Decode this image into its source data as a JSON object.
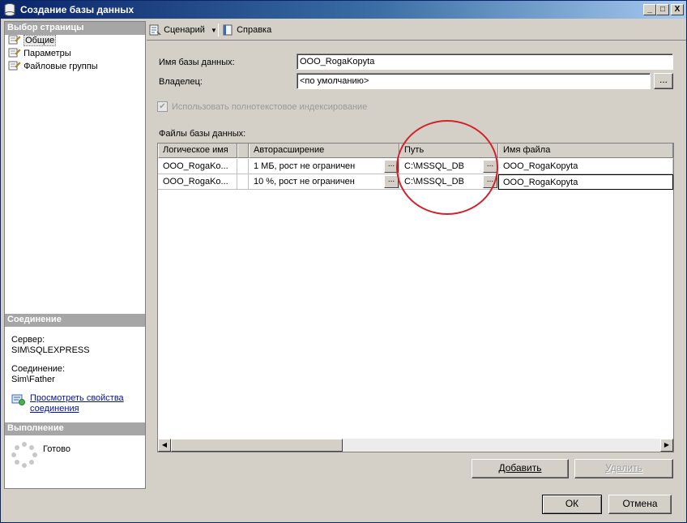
{
  "window": {
    "title": "Создание базы данных",
    "controls": {
      "minimize": "_",
      "maximize": "□",
      "close": "X"
    }
  },
  "left_pane": {
    "header": "Выбор страницы",
    "items": [
      {
        "label": "Общие",
        "selected": true,
        "icon": "page-icon"
      },
      {
        "label": "Параметры",
        "selected": false,
        "icon": "page-icon"
      },
      {
        "label": "Файловые группы",
        "selected": false,
        "icon": "page-icon"
      }
    ],
    "connection": {
      "header": "Соединение",
      "server_label": "Сервер:",
      "server_value": "SIM\\SQLEXPRESS",
      "connection_label": "Соединение:",
      "connection_value": "Sim\\Father",
      "view_props_link": "Просмотреть свойства соединения"
    },
    "execution": {
      "header": "Выполнение",
      "status": "Готово"
    }
  },
  "toolbar": {
    "script_label": "Сценарий",
    "help_label": "Справка"
  },
  "form": {
    "db_name_label": "Имя базы данных:",
    "db_name_value": "OOO_RogaKopyta",
    "owner_label": "Владелец:",
    "owner_value": "<по умолчанию>",
    "fulltext_label": "Использовать полнотекстовое индексирование",
    "fulltext_checked": true,
    "files_label": "Файлы базы данных:"
  },
  "grid": {
    "columns": [
      "Логическое имя",
      "Авторасширение",
      "Путь",
      "Имя файла"
    ],
    "rows": [
      {
        "logical": "OOO_RogaKo...",
        "autogrow": "1 МБ, рост не ограничен",
        "path": "C:\\MSSQL_DB",
        "filename": "OOO_RogaKopyta"
      },
      {
        "logical": "OOO_RogaKo...",
        "autogrow": "10 %, рост не ограничен",
        "path": "C:\\MSSQL_DB",
        "filename": "OOO_RogaKopyta"
      }
    ],
    "ellipsis": "..."
  },
  "buttons": {
    "add": "Добавить",
    "remove": "Удалить",
    "ok": "ОК",
    "cancel": "Отмена",
    "owner_browse": "..."
  },
  "colors": {
    "annotation_circle": "#d2232a",
    "title_gradient_start": "#0a246a",
    "link": "#00129c"
  }
}
